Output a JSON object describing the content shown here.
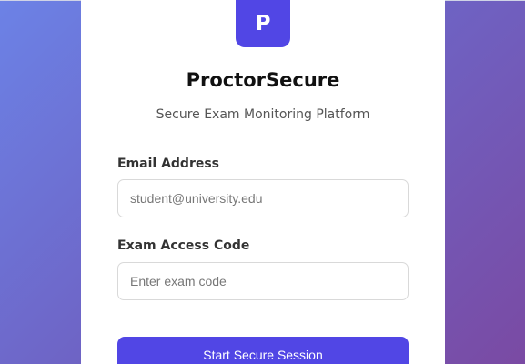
{
  "colors": {
    "accent": "#5146e5",
    "background_gradient": [
      "#6c82e6",
      "#6e63c4",
      "#7a4aa3"
    ],
    "card": "#ffffff"
  },
  "brand": {
    "logo_letter": "P",
    "title": "ProctorSecure",
    "subtitle": "Secure Exam Monitoring Platform"
  },
  "form": {
    "email": {
      "label": "Email Address",
      "placeholder": "student@university.edu",
      "value": ""
    },
    "exam_code": {
      "label": "Exam Access Code",
      "placeholder": "Enter exam code",
      "value": ""
    },
    "submit_label": "Start Secure Session"
  }
}
